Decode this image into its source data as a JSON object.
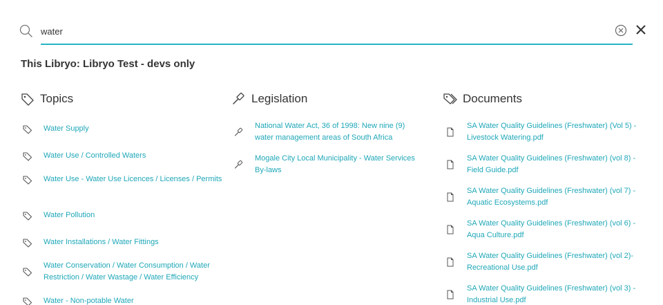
{
  "search": {
    "value": "water",
    "placeholder": "Search"
  },
  "scope_title": "This Libryo: Libryo Test - devs only",
  "topics": {
    "title": "Topics",
    "items": [
      "Water Supply",
      "Water Use / Controlled Waters",
      "Water Use - Water Use Licences / Licenses / Permits",
      "Water Pollution",
      "Water Installations / Water Fittings",
      "Water Conservation / Water Consumption / Water Restriction / Water Wastage / Water Efficiency",
      "Water - Non-potable Water"
    ]
  },
  "legislation": {
    "title": "Legislation",
    "items": [
      "National Water Act, 36 of 1998: New nine (9) water management areas of South Africa",
      "Mogale City Local Municipality - Water Services By-laws"
    ]
  },
  "documents": {
    "title": "Documents",
    "items": [
      "SA Water Quality Guidelines (Freshwater) (Vol 5) - Livestock Watering.pdf",
      "SA Water Quality Guidelines (Freshwater) (vol 8) - Field Guide.pdf",
      "SA Water Quality Guidelines (Freshwater) (vol 7) - Aquatic Ecosystems.pdf",
      "SA Water Quality Guidelines (Freshwater) (vol 6) - Aqua Culture.pdf",
      "SA Water Quality Guidelines (Freshwater) (vol 2)- Recreational Use.pdf",
      "SA Water Quality Guidelines (Freshwater) (vol 3) - Industrial Use.pdf"
    ]
  },
  "colors": {
    "accent": "#26b4c4",
    "link": "#1fa7b8",
    "text": "#333333",
    "icon": "#666666"
  }
}
